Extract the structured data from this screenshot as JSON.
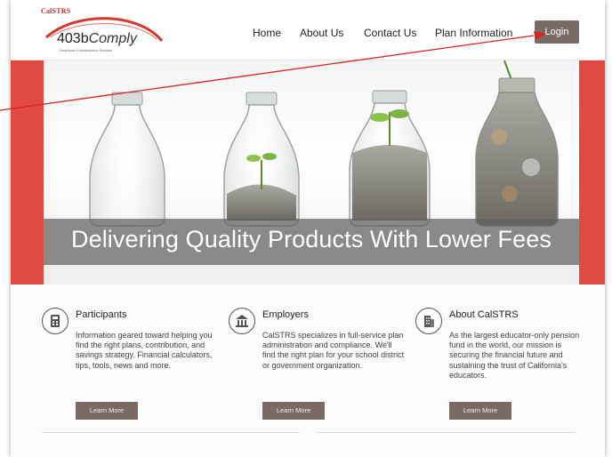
{
  "brand": {
    "org": "CalSTRS",
    "product_prefix": "403b",
    "product_suffix": "Comply",
    "tagline": "Compliance & Administration Solutions",
    "accent_red": "#e14a40",
    "button_color": "#7a6a66"
  },
  "nav": {
    "home": "Home",
    "about": "About Us",
    "contact": "Contact Us",
    "plan_info": "Plan Information",
    "login": "Login"
  },
  "hero": {
    "title": "Delivering Quality Products With Lower Fees"
  },
  "columns": [
    {
      "icon": "calculator-icon",
      "title": "Participants",
      "text": "Information geared toward helping you find the right plans, contribution, and savings strategy. Financial calculators, tips, tools, news and more.",
      "button": "Learn More"
    },
    {
      "icon": "bank-building-icon",
      "title": "Employers",
      "text": "CalSTRS specializes in full-service plan administration and compliance. We'll find the right plan for your school district or government organization.",
      "button": "Learn More"
    },
    {
      "icon": "office-building-icon",
      "title": "About CalSTRS",
      "text": "As the largest educator-only pension fund in the world, our mission is securing the financial future and sustaining the trust of California's educators.",
      "button": "Learn More"
    }
  ]
}
